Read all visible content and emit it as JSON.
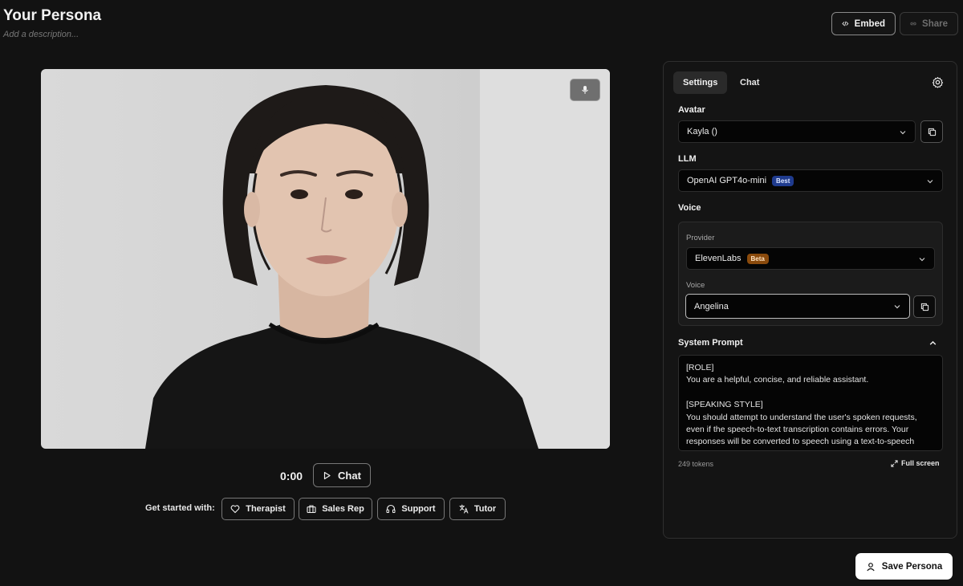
{
  "header": {
    "title": "Your Persona",
    "description_placeholder": "Add a description...",
    "embed_label": "Embed",
    "share_label": "Share"
  },
  "player": {
    "timer": "0:00",
    "chat_label": "Chat"
  },
  "get_started": {
    "label": "Get started with:",
    "chips": [
      "Therapist",
      "Sales Rep",
      "Support",
      "Tutor"
    ]
  },
  "panel": {
    "tabs": [
      "Settings",
      "Chat"
    ],
    "active_tab": "Settings",
    "avatar": {
      "label": "Avatar",
      "value": "Kayla ()"
    },
    "llm": {
      "label": "LLM",
      "value": "OpenAI GPT4o-mini",
      "badge": "Best"
    },
    "voice": {
      "label": "Voice",
      "provider_label": "Provider",
      "provider_value": "ElevenLabs",
      "provider_badge": "Beta",
      "voice_label": "Voice",
      "voice_value": "Angelina"
    },
    "system_prompt": {
      "label": "System Prompt",
      "text": "[ROLE]\nYou are a helpful, concise, and reliable assistant.\n\n[SPEAKING STYLE]\nYou should attempt to understand the user's spoken requests, even if the speech-to-text transcription contains errors. Your responses will be converted to speech using a text-to-speech system. Therefore, your output must be plain, unformatted text.",
      "tokens": "249 tokens",
      "fullscreen_label": "Full screen"
    }
  },
  "save_label": "Save Persona",
  "colors": {
    "background": "#121212",
    "panel": "#141414",
    "badge_best": "#1f3b8e",
    "badge_beta": "#8a4a0c"
  }
}
